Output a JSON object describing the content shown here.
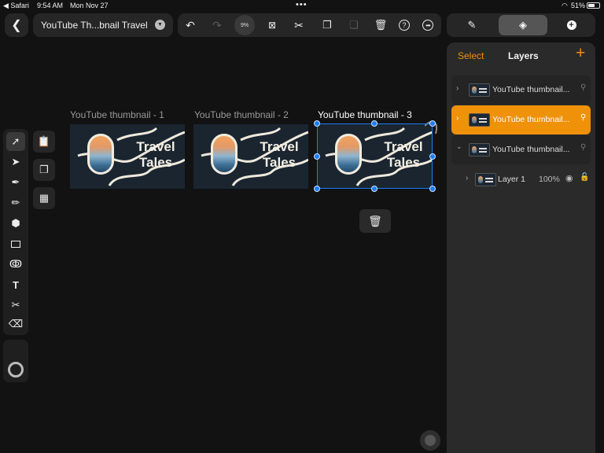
{
  "status_bar": {
    "back_app": "◀ Safari",
    "time": "9:54 AM",
    "date": "Mon Nov 27",
    "battery": "51%"
  },
  "toolbar": {
    "document_title": "YouTube Th...bnail Travel",
    "zoom_level": "9%"
  },
  "panel": {
    "select_label": "Select",
    "title": "Layers",
    "layers": [
      {
        "name": "YouTube thumbnail...",
        "selected": false,
        "expanded": false
      },
      {
        "name": "YouTube thumbnail...",
        "selected": true,
        "expanded": false
      },
      {
        "name": "YouTube thumbnail...",
        "selected": false,
        "expanded": true
      }
    ],
    "sublayer": {
      "name": "Layer 1",
      "opacity": "100%"
    }
  },
  "artboards": [
    {
      "label": "YouTube thumbnail - 1",
      "title": "Travel Tales"
    },
    {
      "label": "YouTube thumbnail - 2",
      "title": "Travel Tales"
    },
    {
      "label": "YouTube thumbnail - 3",
      "title": "Travel Tales"
    }
  ],
  "colors": {
    "accent": "#f0910a",
    "selection": "#1e7bf2",
    "background": "#121212"
  }
}
